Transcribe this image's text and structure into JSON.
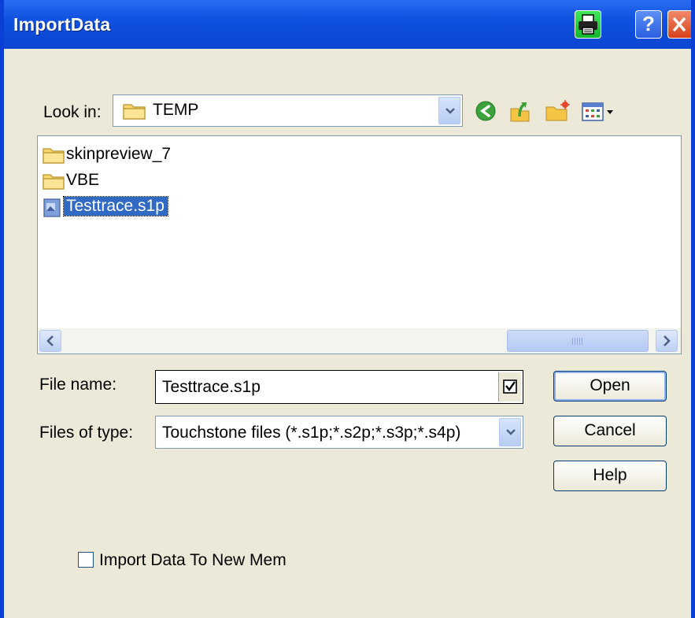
{
  "window": {
    "title": "ImportData",
    "help_glyph": "?"
  },
  "lookin": {
    "label": "Look in:",
    "value": "TEMP"
  },
  "toolbar": {
    "icons": [
      "back-icon",
      "up-folder-icon",
      "new-folder-icon",
      "view-menu-icon"
    ]
  },
  "files": [
    {
      "name": "skinpreview_7",
      "kind": "folder",
      "selected": false
    },
    {
      "name": "VBE",
      "kind": "folder",
      "selected": false
    },
    {
      "name": "Testtrace.s1p",
      "kind": "file",
      "selected": true
    }
  ],
  "filename": {
    "label": "File name:",
    "value": "Testtrace.s1p"
  },
  "filetype": {
    "label": "Files of type:",
    "value": "Touchstone files (*.s1p;*.s2p;*.s3p;*.s4p)"
  },
  "buttons": {
    "open": "Open",
    "cancel": "Cancel",
    "help": "Help"
  },
  "option": {
    "label": "Import Data To New Mem",
    "checked": false
  },
  "colors": {
    "titlebar": "#0a46d0",
    "face": "#ece9d8",
    "selection": "#316ac5",
    "print_button": "#12b82c",
    "close_button": "#d8401a"
  }
}
